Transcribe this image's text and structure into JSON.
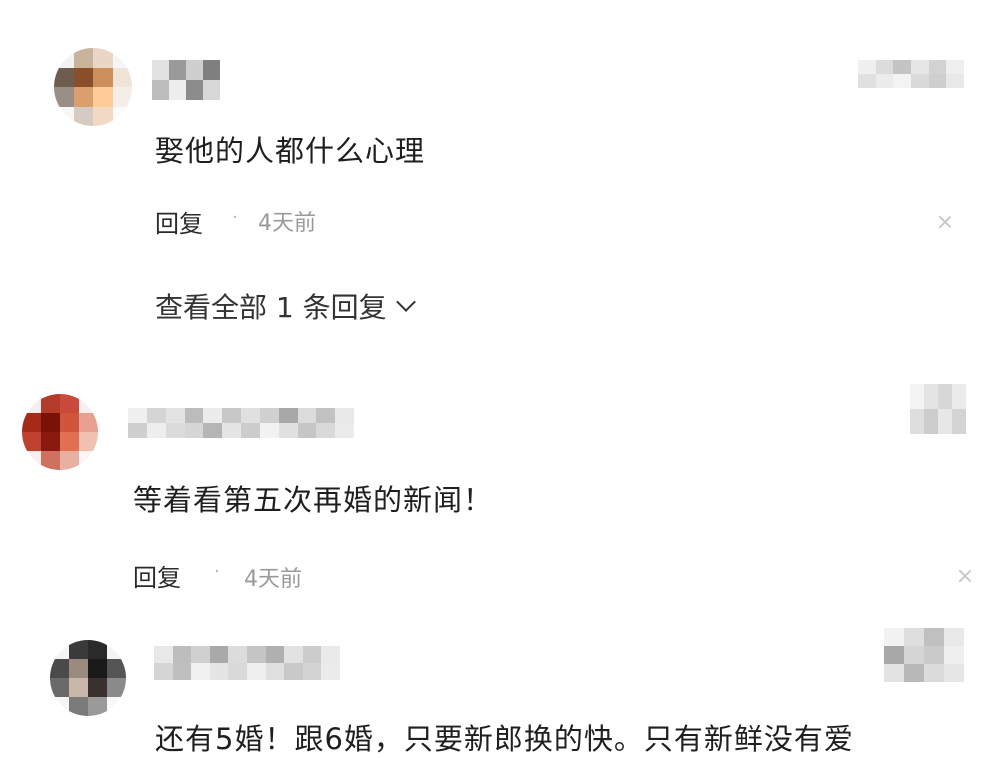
{
  "comments": [
    {
      "text": "娶他的人都什么心理",
      "reply_label": "回复",
      "separator": "·",
      "time": "4天前",
      "view_all_label": "查看全部 1 条回复",
      "avatar_colors": [
        "#f2f2f2",
        "#c9b39a",
        "#e9d6c4",
        "#f5f5f5",
        "#6e5d4f",
        "#8a4e2a",
        "#cc8f5c",
        "#f0e4d8",
        "#9a8f86",
        "#d9a06e",
        "#ffcc99",
        "#f6efe9",
        "#f7f7f7",
        "#d5cbc2",
        "#f1d9c3",
        "#fbfbfb"
      ]
    },
    {
      "text": "等着看第五次再婚的新闻！",
      "reply_label": "回复",
      "separator": "·",
      "time": "4天前",
      "avatar_colors": [
        "#f6eeee",
        "#b43a2a",
        "#c94a3a",
        "#f7efee",
        "#a52a1a",
        "#7a1208",
        "#d1553a",
        "#e8a090",
        "#c04030",
        "#8a1a10",
        "#e07050",
        "#f0c0b0",
        "#f8eeee",
        "#d07060",
        "#e8b0a0",
        "#fbf5f5"
      ]
    },
    {
      "text": "还有5婚！跟6婚，只要新郎换的快。只有新鲜没有爱",
      "avatar_colors": [
        "#f4f4f4",
        "#3a3a3a",
        "#2a2a2a",
        "#f4f4f4",
        "#4a4a4a",
        "#9a8a80",
        "#1a1a1a",
        "#555555",
        "#6a6a6a",
        "#c9b8aa",
        "#3a3030",
        "#8a8a8a",
        "#f6f6f6",
        "#7a7a7a",
        "#9a9a9a",
        "#f8f8f8"
      ]
    }
  ],
  "mosaic_colors": {
    "name_1": [
      "#e2e2e2",
      "#9a9a9a",
      "#cfcfcf",
      "#7f7f7f",
      "#bdbdbd",
      "#ededed",
      "#8c8c8c",
      "#d8d8d8"
    ],
    "badge_1": [
      "#f0f0f0",
      "#dcdcdc",
      "#c4c4c4",
      "#e6e6e6",
      "#d2d2d2",
      "#efefef",
      "#e0e0e0",
      "#ececec",
      "#f3f3f3",
      "#dadada",
      "#cfcfcf",
      "#e8e8e8"
    ],
    "name_2": [
      "#f0f0f0",
      "#d5d5d5",
      "#e3e3e3",
      "#bcbcbc",
      "#ececec",
      "#c8c8c8",
      "#e0e0e0",
      "#d0d0d0",
      "#a8a8a8",
      "#dcdcdc",
      "#c2c2c2",
      "#e9e9e9",
      "#cfcfcf",
      "#eeeeee",
      "#dbdbdb",
      "#d6d6d6",
      "#b5b5b5",
      "#e5e5e5",
      "#cccccc",
      "#f2f2f2",
      "#e1e1e1",
      "#c6c6c6",
      "#d9d9d9",
      "#ebebeb"
    ],
    "badge_2": [
      "#f4f4f4",
      "#e4e4e4",
      "#d7d7d7",
      "#ebebeb",
      "#dedede",
      "#cdcdcd",
      "#e7e7e7",
      "#d4d4d4"
    ],
    "name_3": [
      "#e8e8e8",
      "#bdbdbd",
      "#d0d0d0",
      "#a9a9a9",
      "#dcdcdc",
      "#c5c5c5",
      "#b0b0b0",
      "#e2e2e2",
      "#cccccc",
      "#eaeaea",
      "#d5d5d5",
      "#bfbfbf",
      "#f1f1f1",
      "#e5e5e5",
      "#d9d9d9",
      "#efefef",
      "#e0e0e0",
      "#c9c9c9",
      "#d3d3d3",
      "#ebebeb"
    ],
    "badge_3": [
      "#f2f2f2",
      "#dedede",
      "#c0c0c0",
      "#e9e9e9",
      "#a8a8a8",
      "#d6d6d6",
      "#cacaca",
      "#efefef",
      "#e3e3e3",
      "#b9b9b9",
      "#dbdbdb",
      "#e6e6e6"
    ]
  }
}
